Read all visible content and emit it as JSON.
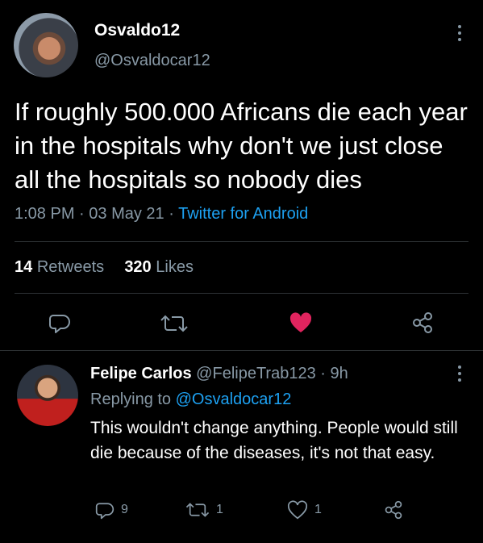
{
  "tweet": {
    "author_name": "Osvaldo12",
    "author_handle": "@Osvaldocar12",
    "text": "If roughly 500.000 Africans die each year in the hospitals why don't we just close all the hospitals so nobody dies",
    "time": "1:08 PM",
    "date": "03 May 21",
    "source": "Twitter for Android",
    "retweets_count": "14",
    "retweets_label": "Retweets",
    "likes_count": "320",
    "likes_label": "Likes",
    "liked": true
  },
  "reply": {
    "author_name": "Felipe Carlos",
    "author_handle": "@FelipeTrab123",
    "age": "9h",
    "replying_prefix": "Replying to",
    "replying_to": "@Osvaldocar12",
    "text": "This wouldn't change anything. People would still die because of  the diseases, it's not that easy.",
    "reply_count": "9",
    "retweet_count": "1",
    "like_count": "1"
  },
  "colors": {
    "background": "#000000",
    "secondary_text": "#8899a6",
    "link": "#1da1f2",
    "like": "#e0245e",
    "divider": "#2f3336"
  },
  "icons": [
    "more-vertical-icon",
    "reply-icon",
    "retweet-icon",
    "heart-icon",
    "share-icon"
  ]
}
